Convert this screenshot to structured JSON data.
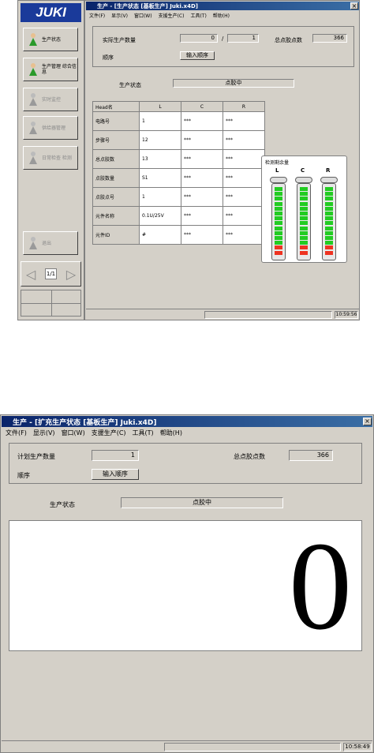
{
  "window1": {
    "title": "生产 - [生产状态 [基板生产] Juki.x4D]",
    "close": "×",
    "menu": [
      "文件(F)",
      "显示(V)",
      "窗口(W)",
      "支援生产(C)",
      "工具(T)",
      "帮助(H)"
    ],
    "logo": "JUKI",
    "sidebar": [
      {
        "label": "生产状态",
        "icon": "person-production-icon",
        "enabled": true
      },
      {
        "label": "生产管理 综合信息",
        "icon": "person-production-manage-icon",
        "enabled": true
      },
      {
        "label": "实时监控",
        "icon": "person-monitor-icon",
        "enabled": false
      },
      {
        "label": "供给器管理",
        "icon": "feeder-icon",
        "enabled": false
      },
      {
        "label": "日常检查 检测",
        "icon": "hand-check-icon",
        "enabled": false
      },
      {
        "label": "退出",
        "icon": "exit-door-icon",
        "enabled": false
      }
    ],
    "nav": {
      "left": "◁",
      "mid": "1/1",
      "right": "▷"
    },
    "info": {
      "actual_qty_label": "实际生产数量",
      "actual_qty": "0",
      "slash": "/",
      "plan_qty": "1",
      "total_dots_label": "总点胶点数",
      "total_dots": "366",
      "sequence_label": "顺序",
      "sequence_button": "输入顺序"
    },
    "status": {
      "label": "生产状态",
      "value": "点胶中"
    },
    "table": {
      "headers": [
        "Head名",
        "L",
        "C",
        "R"
      ],
      "rows": [
        [
          "电路号",
          "1",
          "***",
          "***"
        ],
        [
          "步骤号",
          "12",
          "***",
          "***"
        ],
        [
          "总点胶数",
          "13",
          "***",
          "***"
        ],
        [
          "点胶数量",
          "S1",
          "***",
          "***"
        ],
        [
          "点胶点号",
          "1",
          "***",
          "***"
        ],
        [
          "元件名称",
          "0.1U/25V",
          "***",
          "***"
        ],
        [
          "元件ID",
          "#",
          "***",
          "***"
        ]
      ]
    },
    "gauge": {
      "title": "检测剩余量",
      "labels": [
        "L",
        "C",
        "R"
      ],
      "green_segments": 12,
      "red_segments": 2
    },
    "clock": "10:59:56"
  },
  "window2": {
    "title": "生产 - [扩充生产状态 [基板生产] Juki.x4D]",
    "close": "×",
    "menu": [
      "文件(F)",
      "显示(V)",
      "窗口(W)",
      "支援生产(C)",
      "工具(T)",
      "帮助(H)"
    ],
    "info": {
      "plan_qty_label": "计划生产数量",
      "plan_qty": "1",
      "total_dots_label": "总点胶点数",
      "total_dots": "366",
      "sequence_label": "顺序",
      "sequence_button": "输入顺序"
    },
    "status": {
      "label": "生产状态",
      "value": "点胶中"
    },
    "big_count": "0",
    "clock": "10:58:49"
  }
}
